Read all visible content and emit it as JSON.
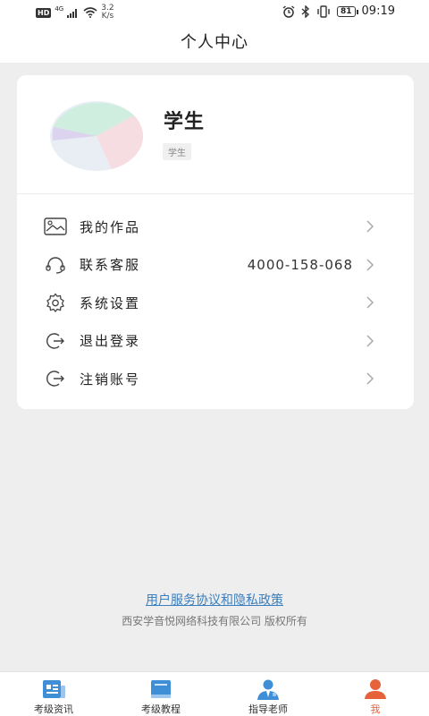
{
  "status_bar": {
    "hd": "HD",
    "network": "4G",
    "speed_value": "3.2",
    "speed_unit": "K/s",
    "battery": "81",
    "time": "09:19"
  },
  "header": {
    "title": "个人中心"
  },
  "profile": {
    "name": "学生",
    "role": "学生"
  },
  "menu": [
    {
      "label": "我的作品",
      "value": "",
      "icon": "image-icon"
    },
    {
      "label": "联系客服",
      "value": "4000-158-068",
      "icon": "headset-icon"
    },
    {
      "label": "系统设置",
      "value": "",
      "icon": "gear-icon"
    },
    {
      "label": "退出登录",
      "value": "",
      "icon": "logout-icon"
    },
    {
      "label": "注销账号",
      "value": "",
      "icon": "logout-icon"
    }
  ],
  "footer": {
    "agreement": "用户服务协议和隐私政策",
    "copyright": "西安学音悦网络科技有限公司 版权所有"
  },
  "tabbar": {
    "tabs": [
      {
        "label": "考级资讯",
        "icon": "news-icon"
      },
      {
        "label": "考级教程",
        "icon": "book-icon"
      },
      {
        "label": "指导老师",
        "icon": "teacher-icon"
      },
      {
        "label": "我",
        "icon": "user-icon",
        "active": true
      }
    ]
  },
  "colors": {
    "accent": "#e5623a",
    "link": "#3b7fbd",
    "tab_icon": "#3f8fd6"
  }
}
